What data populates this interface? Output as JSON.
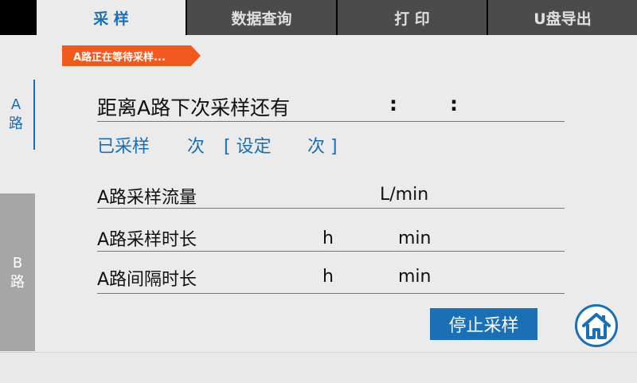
{
  "tabs": [
    {
      "label": "采 样",
      "active": true
    },
    {
      "label": "数据查询",
      "active": false
    },
    {
      "label": "打 印",
      "active": false
    },
    {
      "label": "U盘导出",
      "active": false
    }
  ],
  "status_banner": "A路正在等待采样...",
  "side_tabs": {
    "a": {
      "line1": "A",
      "line2": "路"
    },
    "b": {
      "line1": "B",
      "line2": "路"
    }
  },
  "countdown": {
    "label": "距离A路下次采样还有",
    "separator": ":"
  },
  "count_row": {
    "sampled_label": "已采样",
    "times1": "次",
    "set_open": "[ 设定",
    "times2": "次 ]"
  },
  "params": {
    "flow": {
      "label": "A路采样流量",
      "unit": "L/min"
    },
    "duration": {
      "label": "A路采样时长",
      "unit_h": "h",
      "unit_min": "min"
    },
    "interval": {
      "label": "A路间隔时长",
      "unit_h": "h",
      "unit_min": "min"
    }
  },
  "stop_button": "停止采样",
  "icons": {
    "home": "home-icon"
  },
  "colors": {
    "accent": "#1a6fb5",
    "banner": "#f05a1e",
    "tab_inactive": "#4b4b4b"
  }
}
